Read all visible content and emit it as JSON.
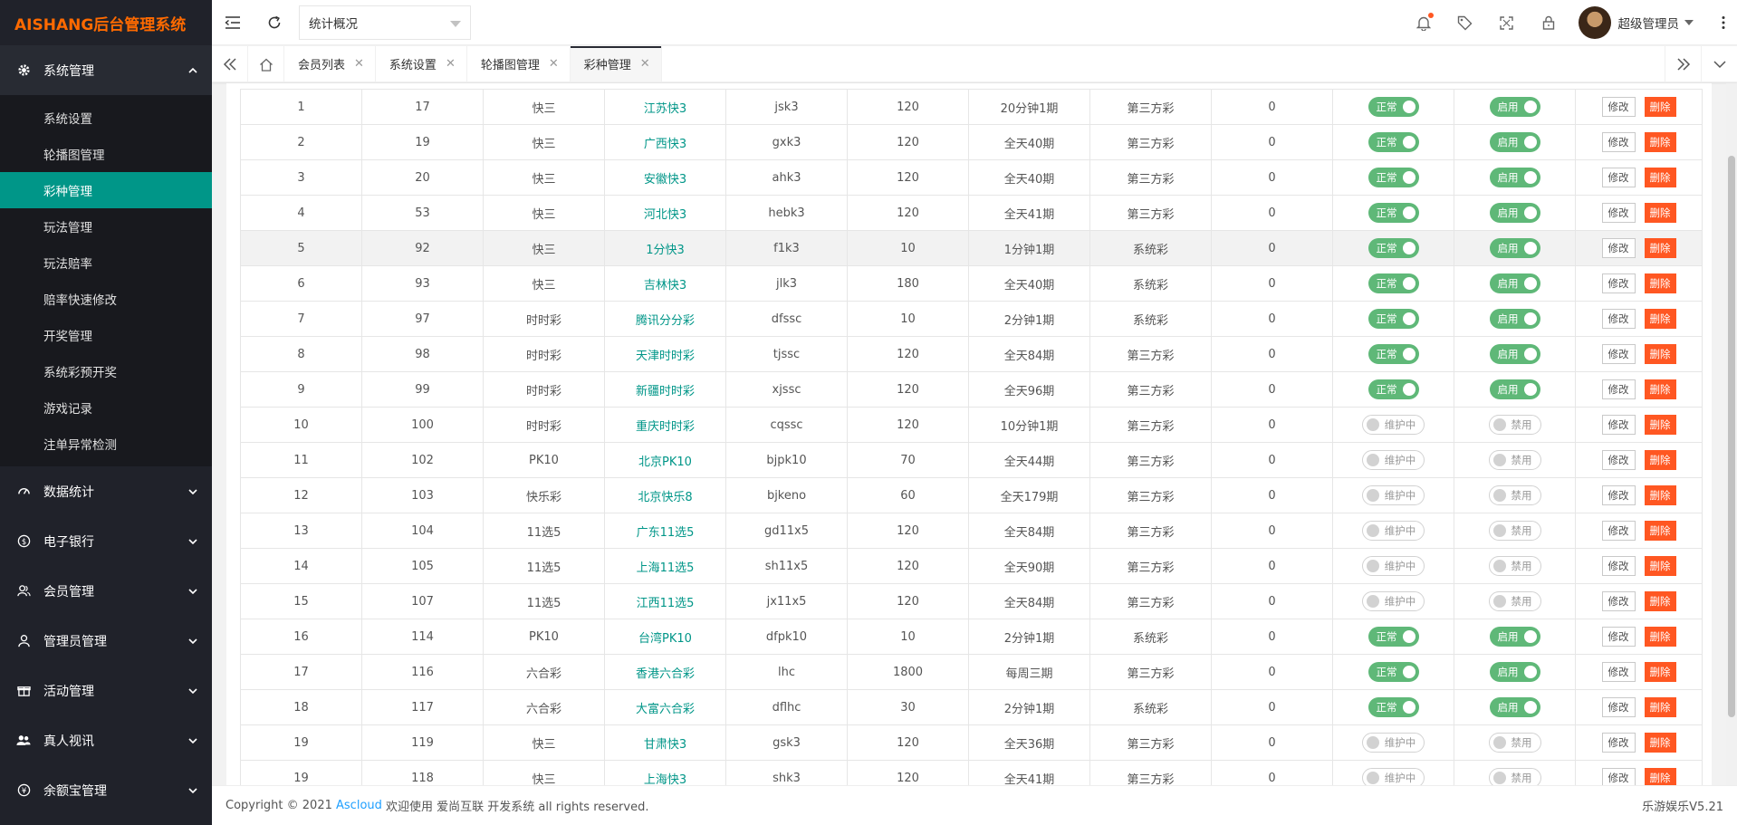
{
  "sidebar": {
    "logo": "AISHANG后台管理系统",
    "groups": [
      {
        "label": "系统管理",
        "icon": "gear-icon",
        "open": true,
        "items": [
          "系统设置",
          "轮播图管理",
          "彩种管理",
          "玩法管理",
          "玩法赔率",
          "赔率快速修改",
          "开奖管理",
          "系统彩预开奖",
          "游戏记录",
          "注单异常检测"
        ],
        "active": "彩种管理"
      },
      {
        "label": "数据统计",
        "icon": "dashboard-icon"
      },
      {
        "label": "电子银行",
        "icon": "dollar-icon"
      },
      {
        "label": "会员管理",
        "icon": "users-icon"
      },
      {
        "label": "管理员管理",
        "icon": "user-icon"
      },
      {
        "label": "活动管理",
        "icon": "gift-icon"
      },
      {
        "label": "真人视讯",
        "icon": "group-icon"
      },
      {
        "label": "余额宝管理",
        "icon": "yen-icon"
      }
    ]
  },
  "header": {
    "select_value": "统计概况",
    "username": "超级管理员"
  },
  "tabs": [
    {
      "label": "会员列表",
      "active": false
    },
    {
      "label": "系统设置",
      "active": false
    },
    {
      "label": "轮播图管理",
      "active": false
    },
    {
      "label": "彩种管理",
      "active": true
    }
  ],
  "table": {
    "rows": [
      {
        "no": "1",
        "id": "17",
        "type": "快三",
        "name": "江苏快3",
        "code": "jsk3",
        "time": "120",
        "period": "20分钟1期",
        "source": "第三方彩",
        "sort": "0",
        "status": "正常",
        "enabled": "启用",
        "on": true
      },
      {
        "no": "2",
        "id": "19",
        "type": "快三",
        "name": "广西快3",
        "code": "gxk3",
        "time": "120",
        "period": "全天40期",
        "source": "第三方彩",
        "sort": "0",
        "status": "正常",
        "enabled": "启用",
        "on": true
      },
      {
        "no": "3",
        "id": "20",
        "type": "快三",
        "name": "安徽快3",
        "code": "ahk3",
        "time": "120",
        "period": "全天40期",
        "source": "第三方彩",
        "sort": "0",
        "status": "正常",
        "enabled": "启用",
        "on": true
      },
      {
        "no": "4",
        "id": "53",
        "type": "快三",
        "name": "河北快3",
        "code": "hebk3",
        "time": "120",
        "period": "全天41期",
        "source": "第三方彩",
        "sort": "0",
        "status": "正常",
        "enabled": "启用",
        "on": true
      },
      {
        "no": "5",
        "id": "92",
        "type": "快三",
        "name": "1分快3",
        "code": "f1k3",
        "time": "10",
        "period": "1分钟1期",
        "source": "系统彩",
        "sort": "0",
        "status": "正常",
        "enabled": "启用",
        "on": true,
        "hover": true
      },
      {
        "no": "6",
        "id": "93",
        "type": "快三",
        "name": "吉林快3",
        "code": "jlk3",
        "time": "180",
        "period": "全天40期",
        "source": "系统彩",
        "sort": "0",
        "status": "正常",
        "enabled": "启用",
        "on": true
      },
      {
        "no": "7",
        "id": "97",
        "type": "时时彩",
        "name": "腾讯分分彩",
        "code": "dfssc",
        "time": "10",
        "period": "2分钟1期",
        "source": "系统彩",
        "sort": "0",
        "status": "正常",
        "enabled": "启用",
        "on": true
      },
      {
        "no": "8",
        "id": "98",
        "type": "时时彩",
        "name": "天津时时彩",
        "code": "tjssc",
        "time": "120",
        "period": "全天84期",
        "source": "第三方彩",
        "sort": "0",
        "status": "正常",
        "enabled": "启用",
        "on": true
      },
      {
        "no": "9",
        "id": "99",
        "type": "时时彩",
        "name": "新疆时时彩",
        "code": "xjssc",
        "time": "120",
        "period": "全天96期",
        "source": "第三方彩",
        "sort": "0",
        "status": "正常",
        "enabled": "启用",
        "on": true
      },
      {
        "no": "10",
        "id": "100",
        "type": "时时彩",
        "name": "重庆时时彩",
        "code": "cqssc",
        "time": "120",
        "period": "10分钟1期",
        "source": "第三方彩",
        "sort": "0",
        "status": "维护中",
        "enabled": "禁用",
        "on": false
      },
      {
        "no": "11",
        "id": "102",
        "type": "PK10",
        "name": "北京PK10",
        "code": "bjpk10",
        "time": "70",
        "period": "全天44期",
        "source": "第三方彩",
        "sort": "0",
        "status": "维护中",
        "enabled": "禁用",
        "on": false
      },
      {
        "no": "12",
        "id": "103",
        "type": "快乐彩",
        "name": "北京快乐8",
        "code": "bjkeno",
        "time": "60",
        "period": "全天179期",
        "source": "第三方彩",
        "sort": "0",
        "status": "维护中",
        "enabled": "禁用",
        "on": false
      },
      {
        "no": "13",
        "id": "104",
        "type": "11选5",
        "name": "广东11选5",
        "code": "gd11x5",
        "time": "120",
        "period": "全天84期",
        "source": "第三方彩",
        "sort": "0",
        "status": "维护中",
        "enabled": "禁用",
        "on": false
      },
      {
        "no": "14",
        "id": "105",
        "type": "11选5",
        "name": "上海11选5",
        "code": "sh11x5",
        "time": "120",
        "period": "全天90期",
        "source": "第三方彩",
        "sort": "0",
        "status": "维护中",
        "enabled": "禁用",
        "on": false
      },
      {
        "no": "15",
        "id": "107",
        "type": "11选5",
        "name": "江西11选5",
        "code": "jx11x5",
        "time": "120",
        "period": "全天84期",
        "source": "第三方彩",
        "sort": "0",
        "status": "维护中",
        "enabled": "禁用",
        "on": false
      },
      {
        "no": "16",
        "id": "114",
        "type": "PK10",
        "name": "台湾PK10",
        "code": "dfpk10",
        "time": "10",
        "period": "2分钟1期",
        "source": "系统彩",
        "sort": "0",
        "status": "正常",
        "enabled": "启用",
        "on": true
      },
      {
        "no": "17",
        "id": "116",
        "type": "六合彩",
        "name": "香港六合彩",
        "code": "lhc",
        "time": "1800",
        "period": "每周三期",
        "source": "第三方彩",
        "sort": "0",
        "status": "正常",
        "enabled": "启用",
        "on": true
      },
      {
        "no": "18",
        "id": "117",
        "type": "六合彩",
        "name": "大富六合彩",
        "code": "dflhc",
        "time": "30",
        "period": "2分钟1期",
        "source": "系统彩",
        "sort": "0",
        "status": "正常",
        "enabled": "启用",
        "on": true
      },
      {
        "no": "19",
        "id": "119",
        "type": "快三",
        "name": "甘肃快3",
        "code": "gsk3",
        "time": "120",
        "period": "全天36期",
        "source": "第三方彩",
        "sort": "0",
        "status": "维护中",
        "enabled": "禁用",
        "on": false
      },
      {
        "no": "19",
        "id": "118",
        "type": "快三",
        "name": "上海快3",
        "code": "shk3",
        "time": "120",
        "period": "全天41期",
        "source": "第三方彩",
        "sort": "0",
        "status": "维护中",
        "enabled": "禁用",
        "on": false
      }
    ],
    "edit_label": "修改",
    "delete_label": "删除"
  },
  "footer": {
    "copyright": "Copyright © 2021",
    "link": "Ascloud",
    "text": "欢迎使用 爱尚互联 开发系统 all rights reserved.",
    "version": "乐游娱乐V5.21"
  },
  "colors": {
    "accent": "#009688",
    "switch_on": "#5fb878",
    "danger": "#ff5722",
    "sidebar_bg": "#20222a",
    "logo": "#ff6a00"
  }
}
